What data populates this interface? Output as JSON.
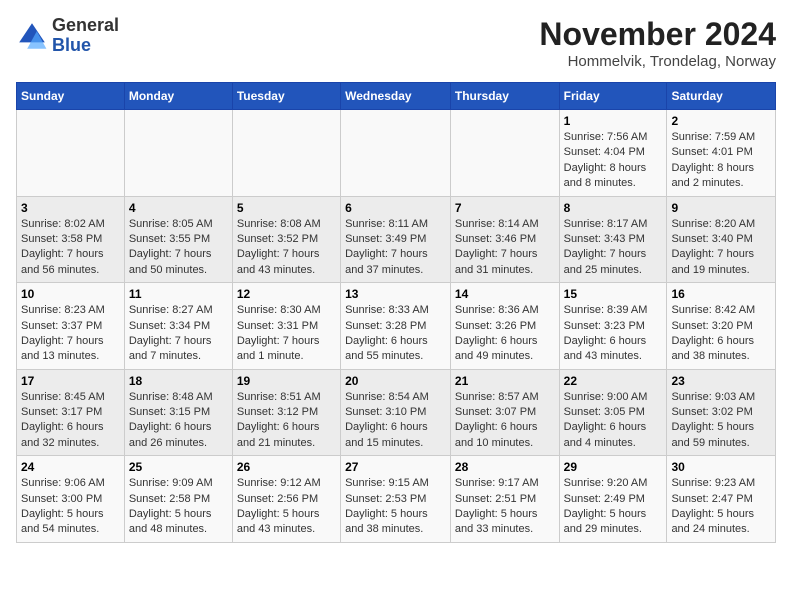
{
  "logo": {
    "general": "General",
    "blue": "Blue"
  },
  "header": {
    "title": "November 2024",
    "location": "Hommelvik, Trondelag, Norway"
  },
  "weekdays": [
    "Sunday",
    "Monday",
    "Tuesday",
    "Wednesday",
    "Thursday",
    "Friday",
    "Saturday"
  ],
  "weeks": [
    [
      {
        "day": "",
        "info": ""
      },
      {
        "day": "",
        "info": ""
      },
      {
        "day": "",
        "info": ""
      },
      {
        "day": "",
        "info": ""
      },
      {
        "day": "",
        "info": ""
      },
      {
        "day": "1",
        "info": "Sunrise: 7:56 AM\nSunset: 4:04 PM\nDaylight: 8 hours and 8 minutes."
      },
      {
        "day": "2",
        "info": "Sunrise: 7:59 AM\nSunset: 4:01 PM\nDaylight: 8 hours and 2 minutes."
      }
    ],
    [
      {
        "day": "3",
        "info": "Sunrise: 8:02 AM\nSunset: 3:58 PM\nDaylight: 7 hours and 56 minutes."
      },
      {
        "day": "4",
        "info": "Sunrise: 8:05 AM\nSunset: 3:55 PM\nDaylight: 7 hours and 50 minutes."
      },
      {
        "day": "5",
        "info": "Sunrise: 8:08 AM\nSunset: 3:52 PM\nDaylight: 7 hours and 43 minutes."
      },
      {
        "day": "6",
        "info": "Sunrise: 8:11 AM\nSunset: 3:49 PM\nDaylight: 7 hours and 37 minutes."
      },
      {
        "day": "7",
        "info": "Sunrise: 8:14 AM\nSunset: 3:46 PM\nDaylight: 7 hours and 31 minutes."
      },
      {
        "day": "8",
        "info": "Sunrise: 8:17 AM\nSunset: 3:43 PM\nDaylight: 7 hours and 25 minutes."
      },
      {
        "day": "9",
        "info": "Sunrise: 8:20 AM\nSunset: 3:40 PM\nDaylight: 7 hours and 19 minutes."
      }
    ],
    [
      {
        "day": "10",
        "info": "Sunrise: 8:23 AM\nSunset: 3:37 PM\nDaylight: 7 hours and 13 minutes."
      },
      {
        "day": "11",
        "info": "Sunrise: 8:27 AM\nSunset: 3:34 PM\nDaylight: 7 hours and 7 minutes."
      },
      {
        "day": "12",
        "info": "Sunrise: 8:30 AM\nSunset: 3:31 PM\nDaylight: 7 hours and 1 minute."
      },
      {
        "day": "13",
        "info": "Sunrise: 8:33 AM\nSunset: 3:28 PM\nDaylight: 6 hours and 55 minutes."
      },
      {
        "day": "14",
        "info": "Sunrise: 8:36 AM\nSunset: 3:26 PM\nDaylight: 6 hours and 49 minutes."
      },
      {
        "day": "15",
        "info": "Sunrise: 8:39 AM\nSunset: 3:23 PM\nDaylight: 6 hours and 43 minutes."
      },
      {
        "day": "16",
        "info": "Sunrise: 8:42 AM\nSunset: 3:20 PM\nDaylight: 6 hours and 38 minutes."
      }
    ],
    [
      {
        "day": "17",
        "info": "Sunrise: 8:45 AM\nSunset: 3:17 PM\nDaylight: 6 hours and 32 minutes."
      },
      {
        "day": "18",
        "info": "Sunrise: 8:48 AM\nSunset: 3:15 PM\nDaylight: 6 hours and 26 minutes."
      },
      {
        "day": "19",
        "info": "Sunrise: 8:51 AM\nSunset: 3:12 PM\nDaylight: 6 hours and 21 minutes."
      },
      {
        "day": "20",
        "info": "Sunrise: 8:54 AM\nSunset: 3:10 PM\nDaylight: 6 hours and 15 minutes."
      },
      {
        "day": "21",
        "info": "Sunrise: 8:57 AM\nSunset: 3:07 PM\nDaylight: 6 hours and 10 minutes."
      },
      {
        "day": "22",
        "info": "Sunrise: 9:00 AM\nSunset: 3:05 PM\nDaylight: 6 hours and 4 minutes."
      },
      {
        "day": "23",
        "info": "Sunrise: 9:03 AM\nSunset: 3:02 PM\nDaylight: 5 hours and 59 minutes."
      }
    ],
    [
      {
        "day": "24",
        "info": "Sunrise: 9:06 AM\nSunset: 3:00 PM\nDaylight: 5 hours and 54 minutes."
      },
      {
        "day": "25",
        "info": "Sunrise: 9:09 AM\nSunset: 2:58 PM\nDaylight: 5 hours and 48 minutes."
      },
      {
        "day": "26",
        "info": "Sunrise: 9:12 AM\nSunset: 2:56 PM\nDaylight: 5 hours and 43 minutes."
      },
      {
        "day": "27",
        "info": "Sunrise: 9:15 AM\nSunset: 2:53 PM\nDaylight: 5 hours and 38 minutes."
      },
      {
        "day": "28",
        "info": "Sunrise: 9:17 AM\nSunset: 2:51 PM\nDaylight: 5 hours and 33 minutes."
      },
      {
        "day": "29",
        "info": "Sunrise: 9:20 AM\nSunset: 2:49 PM\nDaylight: 5 hours and 29 minutes."
      },
      {
        "day": "30",
        "info": "Sunrise: 9:23 AM\nSunset: 2:47 PM\nDaylight: 5 hours and 24 minutes."
      }
    ]
  ]
}
